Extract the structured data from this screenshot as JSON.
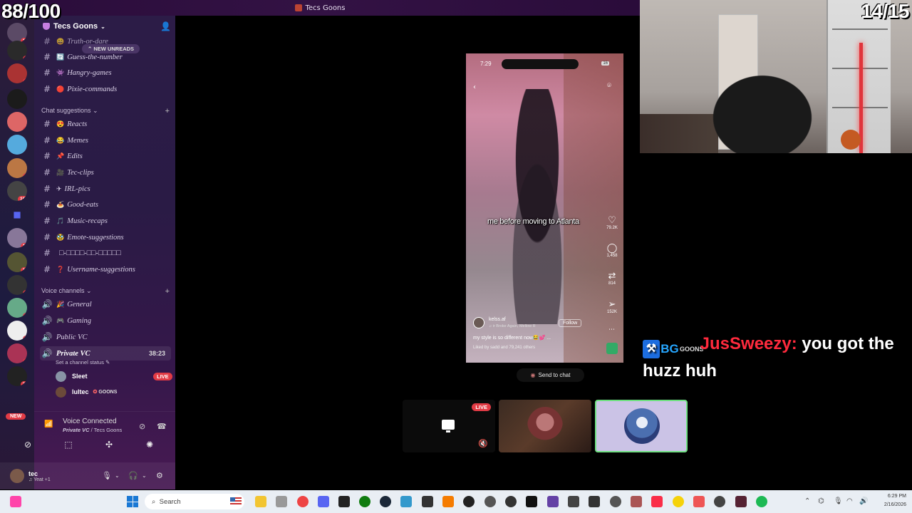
{
  "overlays": {
    "counter_left": "88/100",
    "counter_right": "14/15"
  },
  "window": {
    "title": "Tecs Goons"
  },
  "rail": {
    "new_pill": "NEW",
    "servers": [
      {
        "badge": "17"
      },
      {
        "badge": "2"
      },
      {
        "badge": "1"
      },
      {
        "badge": ""
      },
      {
        "badge": "1"
      },
      {
        "badge": ""
      },
      {
        "badge": "1"
      },
      {
        "badge": "107"
      },
      {
        "badge": ""
      },
      {
        "badge": "18"
      },
      {
        "badge": "14"
      },
      {
        "badge": "4"
      },
      {
        "badge": "6"
      },
      {
        "badge": "3"
      },
      {
        "badge": "1"
      },
      {
        "badge": "26"
      }
    ]
  },
  "sidebar": {
    "server_name": "Tecs Goons",
    "new_unreads": "NEW UNREADS",
    "top_channels": [
      {
        "emoji": "😄",
        "label": "Truth-or-dare"
      },
      {
        "emoji": "🔄",
        "label": "Guess-the-number"
      },
      {
        "emoji": "👾",
        "label": "Hangry-games"
      },
      {
        "emoji": "🔴",
        "label": "Pixie-commands"
      }
    ],
    "cat_chat": "Chat suggestions",
    "chat_channels": [
      {
        "emoji": "😍",
        "label": "Reacts"
      },
      {
        "emoji": "😂",
        "label": "Memes"
      },
      {
        "emoji": "📌",
        "label": "Edits"
      },
      {
        "emoji": "🎥",
        "label": "Tec-clips"
      },
      {
        "emoji": "✈",
        "label": "IRL-pics"
      },
      {
        "emoji": "🍝",
        "label": "Good-eats"
      },
      {
        "emoji": "🎵",
        "label": "Music-recaps"
      },
      {
        "emoji": "🥸",
        "label": "Emote-suggestions"
      },
      {
        "emoji": "",
        "label": "□-□□□□-□□-□□□□□"
      },
      {
        "emoji": "❓",
        "label": "Username-suggestions"
      }
    ],
    "cat_voice": "Voice channels",
    "voice_channels": [
      {
        "emoji": "🎉",
        "label": "General"
      },
      {
        "emoji": "🎮",
        "label": "Gaming"
      },
      {
        "emoji": "",
        "label": "Public VC"
      },
      {
        "emoji": "",
        "label": "Private VC"
      }
    ],
    "private_timer": "38:23",
    "channel_status": "Set a channel status",
    "voice_users": [
      {
        "name": "Sleet",
        "live": "LIVE"
      },
      {
        "name": "lultec",
        "tag": "GOONS"
      }
    ],
    "voice_connected": {
      "title": "Voice Connected",
      "channel": "Private VC",
      "server": "Tecs Goons"
    },
    "user": {
      "name": "tec",
      "status": "Yeat +1"
    }
  },
  "stream": {
    "time": "7:29",
    "battery": "16",
    "caption": "me before moving to Atlanta",
    "likes": "79.2K",
    "comments": "1,458",
    "reposts": "814",
    "shares": "152K",
    "username": "kelss.af",
    "song": "♫ ir Broke Again, Mellow R",
    "follow": "Follow",
    "description": "my style is so different now😂💕 ...",
    "liked_by": "Liked by sadd and 79,241 others",
    "send_to_chat": "Send to chat"
  },
  "tiles": {
    "live": "LIVE"
  },
  "chat": {
    "badge3": "GOONS",
    "username": "JusSweezy:",
    "message": " you got the huzz huh"
  },
  "taskbar": {
    "search": "Search",
    "time": "6:29 PM",
    "date": "2/16/2026"
  }
}
